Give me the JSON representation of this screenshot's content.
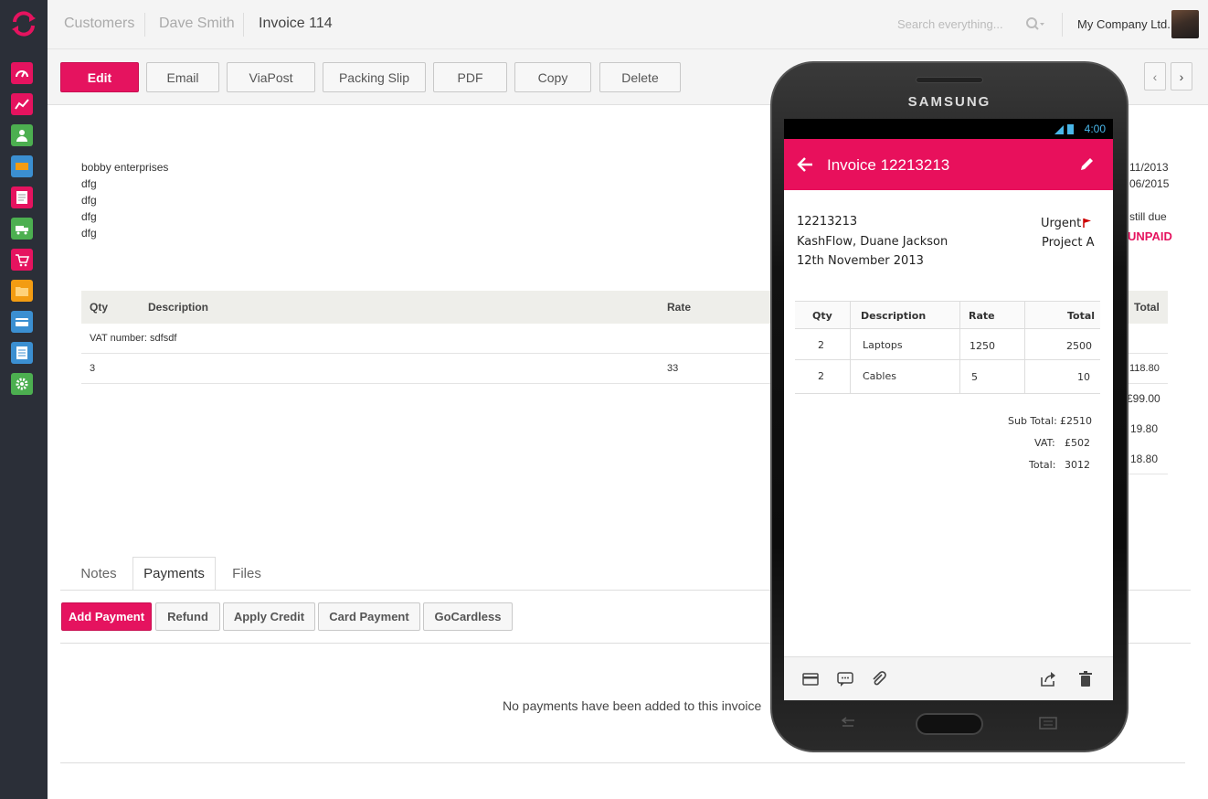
{
  "breadcrumb": {
    "customers": "Customers",
    "customer": "Dave Smith",
    "invoice": "Invoice 114"
  },
  "search": {
    "placeholder": "Search everything..."
  },
  "company": "My Company Ltd.",
  "toolbar": {
    "edit": "Edit",
    "email": "Email",
    "viapost": "ViaPost",
    "packing_slip": "Packing Slip",
    "pdf": "PDF",
    "copy": "Copy",
    "delete": "Delete"
  },
  "address_lines": [
    "bobby enterprises",
    "dfg",
    "dfg",
    "dfg",
    "dfg"
  ],
  "right_info": {
    "date1": "11/2013",
    "date2": "06/2015",
    "still_due": "still due",
    "status": "UNPAID"
  },
  "invoice_table": {
    "headers": {
      "qty": "Qty",
      "description": "Description",
      "rate": "Rate",
      "total": "Total"
    },
    "vat_row": "VAT number: sdfsdf",
    "row": {
      "qty": "3",
      "rate": "33",
      "total": "118.80"
    },
    "totals": [
      "£99.00",
      "19.80",
      "18.80"
    ]
  },
  "tabs": {
    "notes": "Notes",
    "payments": "Payments",
    "files": "Files"
  },
  "payment_buttons": {
    "add": "Add Payment",
    "refund": "Refund",
    "apply_credit": "Apply Credit",
    "card": "Card Payment",
    "gocardless": "GoCardless"
  },
  "no_payments": "No payments have been added to this invoice",
  "phone": {
    "brand": "SAMSUNG",
    "time": "4:00",
    "title": "Invoice 12213213",
    "number": "12213213",
    "customer": "KashFlow, Duane Jackson",
    "date": "12th November 2013",
    "urgent": "Urgent",
    "project": "Project A",
    "table": {
      "headers": {
        "qty": "Qty",
        "description": "Description",
        "rate": "Rate",
        "total": "Total"
      },
      "rows": [
        {
          "qty": "2",
          "description": "Laptops",
          "rate": "1250",
          "total": "2500"
        },
        {
          "qty": "2",
          "description": "Cables",
          "rate": "5",
          "total": "10"
        }
      ]
    },
    "subtotal_label": "Sub Total:",
    "subtotal": "£2510",
    "vat_label": "VAT:",
    "vat": "£502",
    "total_label": "Total:",
    "total": "3012"
  },
  "colors": {
    "accent": "#e5135f",
    "sidebar": "#2b2f38"
  }
}
